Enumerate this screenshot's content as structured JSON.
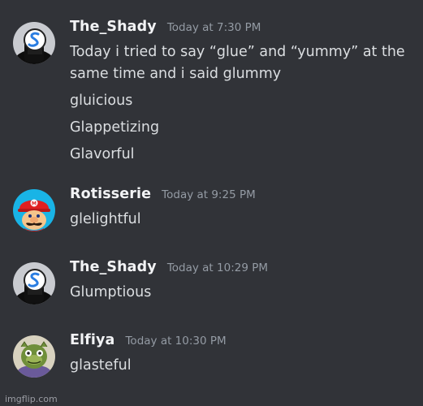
{
  "messages": [
    {
      "username": "The_Shady",
      "timestamp": "Today at 7:30 PM",
      "avatar_icon": "shady-avatar-icon",
      "lines": [
        "Today i tried to say “glue” and “yummy” at the",
        "same time and i said glummy",
        "gluicious",
        "Glappetizing",
        "Glavorful"
      ]
    },
    {
      "username": "Rotisserie",
      "timestamp": "Today at 9:25 PM",
      "avatar_icon": "mario-avatar-icon",
      "lines": [
        "glelightful"
      ]
    },
    {
      "username": "The_Shady",
      "timestamp": "Today at 10:29 PM",
      "avatar_icon": "shady-avatar-icon",
      "lines": [
        "Glumptious"
      ]
    },
    {
      "username": "Elfiya",
      "timestamp": "Today at 10:30 PM",
      "avatar_icon": "fish-person-avatar-icon",
      "lines": [
        "glasteful"
      ]
    }
  ],
  "watermark": "imgflip.com",
  "colors": {
    "background": "#313338",
    "username": "#f2f3f5",
    "timestamp": "#949ba4",
    "message_text": "#dbdee1"
  }
}
